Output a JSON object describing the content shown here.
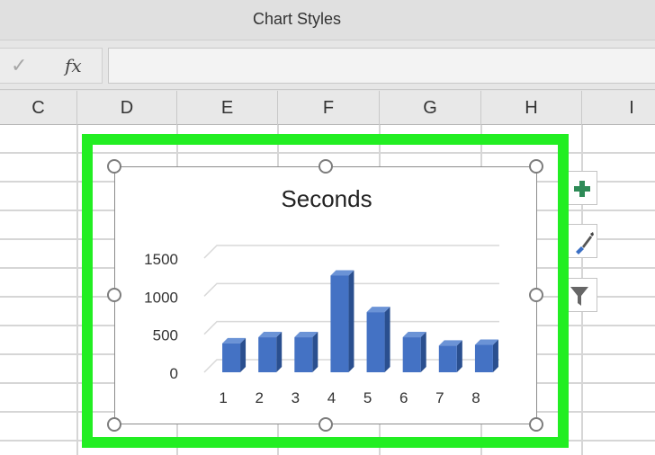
{
  "window": {
    "title": "Chart Styles"
  },
  "formula_bar": {
    "enter_symbol": "✓",
    "function_symbol": "fx",
    "value": ""
  },
  "columns": [
    "C",
    "D",
    "E",
    "F",
    "G",
    "H",
    "I"
  ],
  "chart_data": {
    "type": "bar",
    "title": "Seconds",
    "style": "3d-column",
    "categories": [
      "1",
      "2",
      "3",
      "4",
      "5",
      "6",
      "7",
      "8"
    ],
    "values": [
      380,
      460,
      460,
      1270,
      790,
      460,
      350,
      360
    ],
    "yticks": [
      "0",
      "500",
      "1000",
      "1500"
    ],
    "ylim": [
      0,
      1500
    ],
    "grid": true,
    "legend": "none",
    "bar_color": "#4472c4"
  },
  "side_buttons": [
    {
      "icon": "plus-icon",
      "name": "chart-elements"
    },
    {
      "icon": "paintbrush-icon",
      "name": "chart-styles"
    },
    {
      "icon": "filter-icon",
      "name": "chart-filters"
    }
  ],
  "colors": {
    "selection_highlight": "#22ee22",
    "plus": "#2e8b57"
  }
}
